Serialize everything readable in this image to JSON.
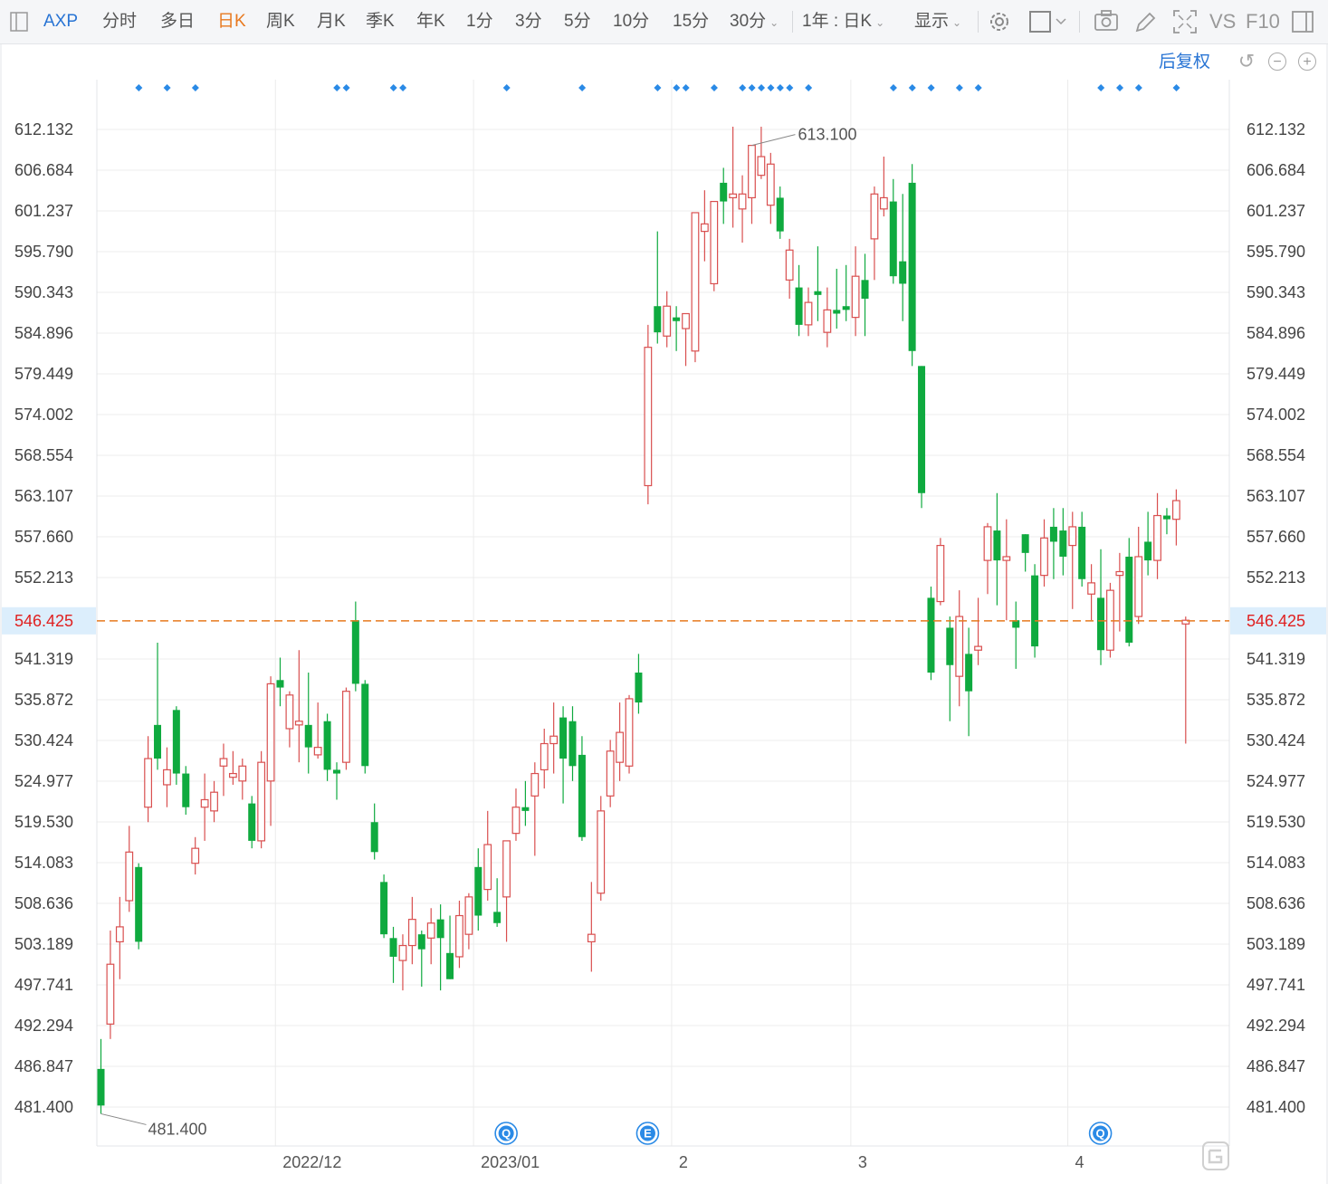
{
  "toolbar": {
    "symbol": "AXP",
    "periods": [
      "分时",
      "多日",
      "日K",
      "周K",
      "月K",
      "季K",
      "年K",
      "1分",
      "3分",
      "5分",
      "10分",
      "15分",
      "30分"
    ],
    "active_period": "日K",
    "range_select": "1年 : 日K",
    "display_select": "显示",
    "vs_label": "VS",
    "f10_label": "F10"
  },
  "adjust_label": "后复权",
  "colors": {
    "up": "#d94f4f",
    "down": "#0faa3f",
    "current_line": "#e8791f",
    "current_label_bg": "#dceefc",
    "current_label_text": "#e02020",
    "event_blue": "#2a8ae6",
    "grid": "#ececec"
  },
  "chart_data": {
    "type": "candlestick",
    "yticks": [
      "612.132",
      "606.684",
      "601.237",
      "595.790",
      "590.343",
      "584.896",
      "579.449",
      "574.002",
      "568.554",
      "563.107",
      "557.660",
      "552.213",
      "546.425",
      "541.319",
      "535.872",
      "530.424",
      "524.977",
      "519.530",
      "514.083",
      "508.636",
      "503.189",
      "497.741",
      "492.294",
      "486.847",
      "481.400"
    ],
    "ylim": [
      481.4,
      612.132
    ],
    "xlabels": [
      "2022/12",
      "2023/01",
      "2",
      "3",
      "4"
    ],
    "xlabel_index": [
      19,
      40,
      61,
      80,
      103
    ],
    "current_price": "546.425",
    "max_label": "613.100",
    "min_label": "481.400",
    "max_index": 69,
    "min_index": 0,
    "event_marker_index": [
      2,
      5,
      8,
      23,
      24,
      29,
      30,
      41,
      49,
      57,
      59,
      60,
      63,
      66,
      67,
      68,
      69,
      70,
      71,
      73,
      82,
      84,
      86,
      89,
      91,
      104,
      106,
      108,
      112
    ],
    "badges": [
      {
        "label": "Q",
        "index": 42
      },
      {
        "label": "E",
        "index": 57
      },
      {
        "label": "Q",
        "index": 105
      }
    ],
    "candles": [
      {
        "o": 486.5,
        "h": 490.5,
        "l": 480.5,
        "c": 481.6
      },
      {
        "o": 492.5,
        "h": 505.0,
        "l": 490.5,
        "c": 500.5
      },
      {
        "o": 503.5,
        "h": 509.5,
        "l": 498.5,
        "c": 505.5
      },
      {
        "o": 509.0,
        "h": 519.0,
        "l": 507.5,
        "c": 515.5
      },
      {
        "o": 513.5,
        "h": 514.0,
        "l": 502.5,
        "c": 503.5
      },
      {
        "o": 521.5,
        "h": 531.0,
        "l": 519.5,
        "c": 528.0
      },
      {
        "o": 532.5,
        "h": 543.5,
        "l": 526.5,
        "c": 528.0
      },
      {
        "o": 524.5,
        "h": 529.5,
        "l": 521.5,
        "c": 526.5
      },
      {
        "o": 534.5,
        "h": 535.0,
        "l": 524.5,
        "c": 526.0
      },
      {
        "o": 526.0,
        "h": 527.0,
        "l": 520.5,
        "c": 521.5
      },
      {
        "o": 514.0,
        "h": 517.5,
        "l": 512.5,
        "c": 516.0
      },
      {
        "o": 521.5,
        "h": 526.0,
        "l": 517.0,
        "c": 522.5
      },
      {
        "o": 521.0,
        "h": 525.0,
        "l": 519.5,
        "c": 523.5
      },
      {
        "o": 527.0,
        "h": 530.0,
        "l": 523.0,
        "c": 528.0
      },
      {
        "o": 525.5,
        "h": 529.0,
        "l": 524.5,
        "c": 526.0
      },
      {
        "o": 525.0,
        "h": 528.0,
        "l": 522.5,
        "c": 527.0
      },
      {
        "o": 522.0,
        "h": 523.0,
        "l": 516.0,
        "c": 517.0
      },
      {
        "o": 517.0,
        "h": 529.0,
        "l": 516.0,
        "c": 527.5
      },
      {
        "o": 525.0,
        "h": 539.0,
        "l": 519.0,
        "c": 538.0
      },
      {
        "o": 538.5,
        "h": 541.5,
        "l": 535.0,
        "c": 537.5
      },
      {
        "o": 532.0,
        "h": 537.0,
        "l": 529.5,
        "c": 536.5
      },
      {
        "o": 532.5,
        "h": 542.5,
        "l": 527.5,
        "c": 533.0
      },
      {
        "o": 532.5,
        "h": 539.5,
        "l": 526.0,
        "c": 529.5
      },
      {
        "o": 528.5,
        "h": 535.5,
        "l": 528.0,
        "c": 529.5
      },
      {
        "o": 533.0,
        "h": 534.0,
        "l": 525.0,
        "c": 526.5
      },
      {
        "o": 526.5,
        "h": 527.5,
        "l": 522.5,
        "c": 526.0
      },
      {
        "o": 527.5,
        "h": 537.5,
        "l": 526.5,
        "c": 537.0
      },
      {
        "o": 546.5,
        "h": 549.0,
        "l": 537.0,
        "c": 538.0
      },
      {
        "o": 538.0,
        "h": 538.5,
        "l": 526.0,
        "c": 527.0
      },
      {
        "o": 519.5,
        "h": 522.0,
        "l": 514.5,
        "c": 515.5
      },
      {
        "o": 511.5,
        "h": 512.5,
        "l": 504.0,
        "c": 504.5
      },
      {
        "o": 504.0,
        "h": 505.5,
        "l": 498.0,
        "c": 501.5
      },
      {
        "o": 501.0,
        "h": 504.5,
        "l": 497.0,
        "c": 503.0
      },
      {
        "o": 503.0,
        "h": 509.5,
        "l": 500.5,
        "c": 506.5
      },
      {
        "o": 504.5,
        "h": 505.0,
        "l": 497.5,
        "c": 502.5
      },
      {
        "o": 504.0,
        "h": 508.0,
        "l": 500.5,
        "c": 506.0
      },
      {
        "o": 506.5,
        "h": 508.5,
        "l": 497.0,
        "c": 504.0
      },
      {
        "o": 502.0,
        "h": 507.0,
        "l": 498.5,
        "c": 498.5
      },
      {
        "o": 501.5,
        "h": 509.0,
        "l": 500.0,
        "c": 507.0
      },
      {
        "o": 504.5,
        "h": 510.0,
        "l": 502.5,
        "c": 509.5
      },
      {
        "o": 513.5,
        "h": 516.0,
        "l": 505.0,
        "c": 507.0
      },
      {
        "o": 510.5,
        "h": 521.0,
        "l": 509.0,
        "c": 516.5
      },
      {
        "o": 507.5,
        "h": 512.0,
        "l": 505.5,
        "c": 506.0
      },
      {
        "o": 509.5,
        "h": 514.5,
        "l": 503.5,
        "c": 517.0
      },
      {
        "o": 518.0,
        "h": 524.0,
        "l": 517.0,
        "c": 521.5
      },
      {
        "o": 521.5,
        "h": 525.0,
        "l": 519.0,
        "c": 521.0
      },
      {
        "o": 523.0,
        "h": 527.5,
        "l": 515.0,
        "c": 526.0
      },
      {
        "o": 526.5,
        "h": 532.0,
        "l": 524.0,
        "c": 530.0
      },
      {
        "o": 530.0,
        "h": 535.5,
        "l": 526.0,
        "c": 531.0
      },
      {
        "o": 533.5,
        "h": 535.0,
        "l": 522.0,
        "c": 528.0
      },
      {
        "o": 533.0,
        "h": 535.0,
        "l": 525.0,
        "c": 527.0
      },
      {
        "o": 528.5,
        "h": 531.0,
        "l": 517.0,
        "c": 517.5
      },
      {
        "o": 503.5,
        "h": 511.5,
        "l": 499.5,
        "c": 504.5
      },
      {
        "o": 510.0,
        "h": 523.0,
        "l": 509.0,
        "c": 521.0
      },
      {
        "o": 523.0,
        "h": 530.5,
        "l": 521.5,
        "c": 529.0
      },
      {
        "o": 527.5,
        "h": 535.5,
        "l": 525.0,
        "c": 531.5
      },
      {
        "o": 527.0,
        "h": 536.5,
        "l": 526.0,
        "c": 536.0
      },
      {
        "o": 539.5,
        "h": 542.0,
        "l": 534.0,
        "c": 535.5
      },
      {
        "o": 564.5,
        "h": 586.0,
        "l": 562.0,
        "c": 583.0
      },
      {
        "o": 588.5,
        "h": 598.5,
        "l": 583.5,
        "c": 585.0
      },
      {
        "o": 584.5,
        "h": 590.5,
        "l": 583.0,
        "c": 588.5
      },
      {
        "o": 587.0,
        "h": 588.5,
        "l": 582.5,
        "c": 586.5
      },
      {
        "o": 585.5,
        "h": 587.0,
        "l": 580.5,
        "c": 587.5
      },
      {
        "o": 582.5,
        "h": 601.0,
        "l": 581.0,
        "c": 601.0
      },
      {
        "o": 598.5,
        "h": 604.0,
        "l": 594.5,
        "c": 599.5
      },
      {
        "o": 591.5,
        "h": 602.5,
        "l": 590.5,
        "c": 602.5
      },
      {
        "o": 605.0,
        "h": 607.0,
        "l": 599.5,
        "c": 602.5
      },
      {
        "o": 603.0,
        "h": 612.5,
        "l": 599.0,
        "c": 603.5
      },
      {
        "o": 601.5,
        "h": 606.0,
        "l": 597.0,
        "c": 603.5
      },
      {
        "o": 603.0,
        "h": 610.0,
        "l": 599.5,
        "c": 610.0
      },
      {
        "o": 606.0,
        "h": 612.5,
        "l": 605.5,
        "c": 608.5
      },
      {
        "o": 602.0,
        "h": 609.0,
        "l": 599.5,
        "c": 607.5
      },
      {
        "o": 603.0,
        "h": 604.5,
        "l": 597.5,
        "c": 598.5
      },
      {
        "o": 592.0,
        "h": 597.5,
        "l": 589.5,
        "c": 596.0
      },
      {
        "o": 591.0,
        "h": 594.0,
        "l": 584.5,
        "c": 586.0
      },
      {
        "o": 586.0,
        "h": 591.0,
        "l": 584.5,
        "c": 589.0
      },
      {
        "o": 590.5,
        "h": 596.5,
        "l": 586.5,
        "c": 590.0
      },
      {
        "o": 585.0,
        "h": 591.0,
        "l": 583.0,
        "c": 588.0
      },
      {
        "o": 588.0,
        "h": 593.5,
        "l": 585.5,
        "c": 587.5
      },
      {
        "o": 588.5,
        "h": 594.0,
        "l": 586.5,
        "c": 588.0
      },
      {
        "o": 587.0,
        "h": 596.5,
        "l": 584.5,
        "c": 592.5
      },
      {
        "o": 592.0,
        "h": 595.5,
        "l": 584.5,
        "c": 589.5
      },
      {
        "o": 597.5,
        "h": 604.5,
        "l": 592.0,
        "c": 603.5
      },
      {
        "o": 601.5,
        "h": 608.5,
        "l": 600.5,
        "c": 603.0
      },
      {
        "o": 602.5,
        "h": 605.5,
        "l": 591.5,
        "c": 592.5
      },
      {
        "o": 594.5,
        "h": 603.5,
        "l": 586.5,
        "c": 591.5
      },
      {
        "o": 605.0,
        "h": 607.5,
        "l": 580.5,
        "c": 582.5
      },
      {
        "o": 580.5,
        "h": 580.5,
        "l": 561.5,
        "c": 563.5
      },
      {
        "o": 549.5,
        "h": 551.0,
        "l": 538.5,
        "c": 539.5
      },
      {
        "o": 549.0,
        "h": 557.5,
        "l": 548.5,
        "c": 556.5
      },
      {
        "o": 545.5,
        "h": 547.0,
        "l": 533.0,
        "c": 540.5
      },
      {
        "o": 539.0,
        "h": 550.5,
        "l": 535.0,
        "c": 547.0
      },
      {
        "o": 542.0,
        "h": 545.5,
        "l": 531.0,
        "c": 537.0
      },
      {
        "o": 542.5,
        "h": 549.5,
        "l": 540.5,
        "c": 543.0
      },
      {
        "o": 554.5,
        "h": 559.5,
        "l": 550.0,
        "c": 559.0
      },
      {
        "o": 558.5,
        "h": 563.5,
        "l": 548.5,
        "c": 554.5
      },
      {
        "o": 554.5,
        "h": 560.0,
        "l": 546.5,
        "c": 555.0
      },
      {
        "o": 546.5,
        "h": 549.0,
        "l": 540.0,
        "c": 545.5
      },
      {
        "o": 558.0,
        "h": 558.0,
        "l": 553.0,
        "c": 555.5
      },
      {
        "o": 552.5,
        "h": 554.0,
        "l": 541.5,
        "c": 543.0
      },
      {
        "o": 552.5,
        "h": 560.0,
        "l": 551.0,
        "c": 557.5
      },
      {
        "o": 559.0,
        "h": 561.5,
        "l": 552.0,
        "c": 557.0
      },
      {
        "o": 558.5,
        "h": 561.5,
        "l": 552.5,
        "c": 555.0
      },
      {
        "o": 556.5,
        "h": 561.0,
        "l": 548.0,
        "c": 559.0
      },
      {
        "o": 559.0,
        "h": 561.0,
        "l": 551.0,
        "c": 552.0
      },
      {
        "o": 550.0,
        "h": 554.0,
        "l": 546.5,
        "c": 551.5
      },
      {
        "o": 549.5,
        "h": 556.0,
        "l": 540.5,
        "c": 542.5
      },
      {
        "o": 542.5,
        "h": 551.5,
        "l": 541.5,
        "c": 550.5
      },
      {
        "o": 552.5,
        "h": 555.5,
        "l": 545.0,
        "c": 553.0
      },
      {
        "o": 555.0,
        "h": 557.5,
        "l": 543.0,
        "c": 543.5
      },
      {
        "o": 547.0,
        "h": 559.0,
        "l": 546.0,
        "c": 555.0
      },
      {
        "o": 557.0,
        "h": 561.0,
        "l": 552.5,
        "c": 554.5
      },
      {
        "o": 554.5,
        "h": 563.5,
        "l": 552.0,
        "c": 560.5
      },
      {
        "o": 560.5,
        "h": 561.5,
        "l": 558.0,
        "c": 560.0
      },
      {
        "o": 560.0,
        "h": 564.0,
        "l": 556.5,
        "c": 562.5
      },
      {
        "o": 546.0,
        "h": 547.0,
        "l": 530.0,
        "c": 546.5
      }
    ]
  }
}
